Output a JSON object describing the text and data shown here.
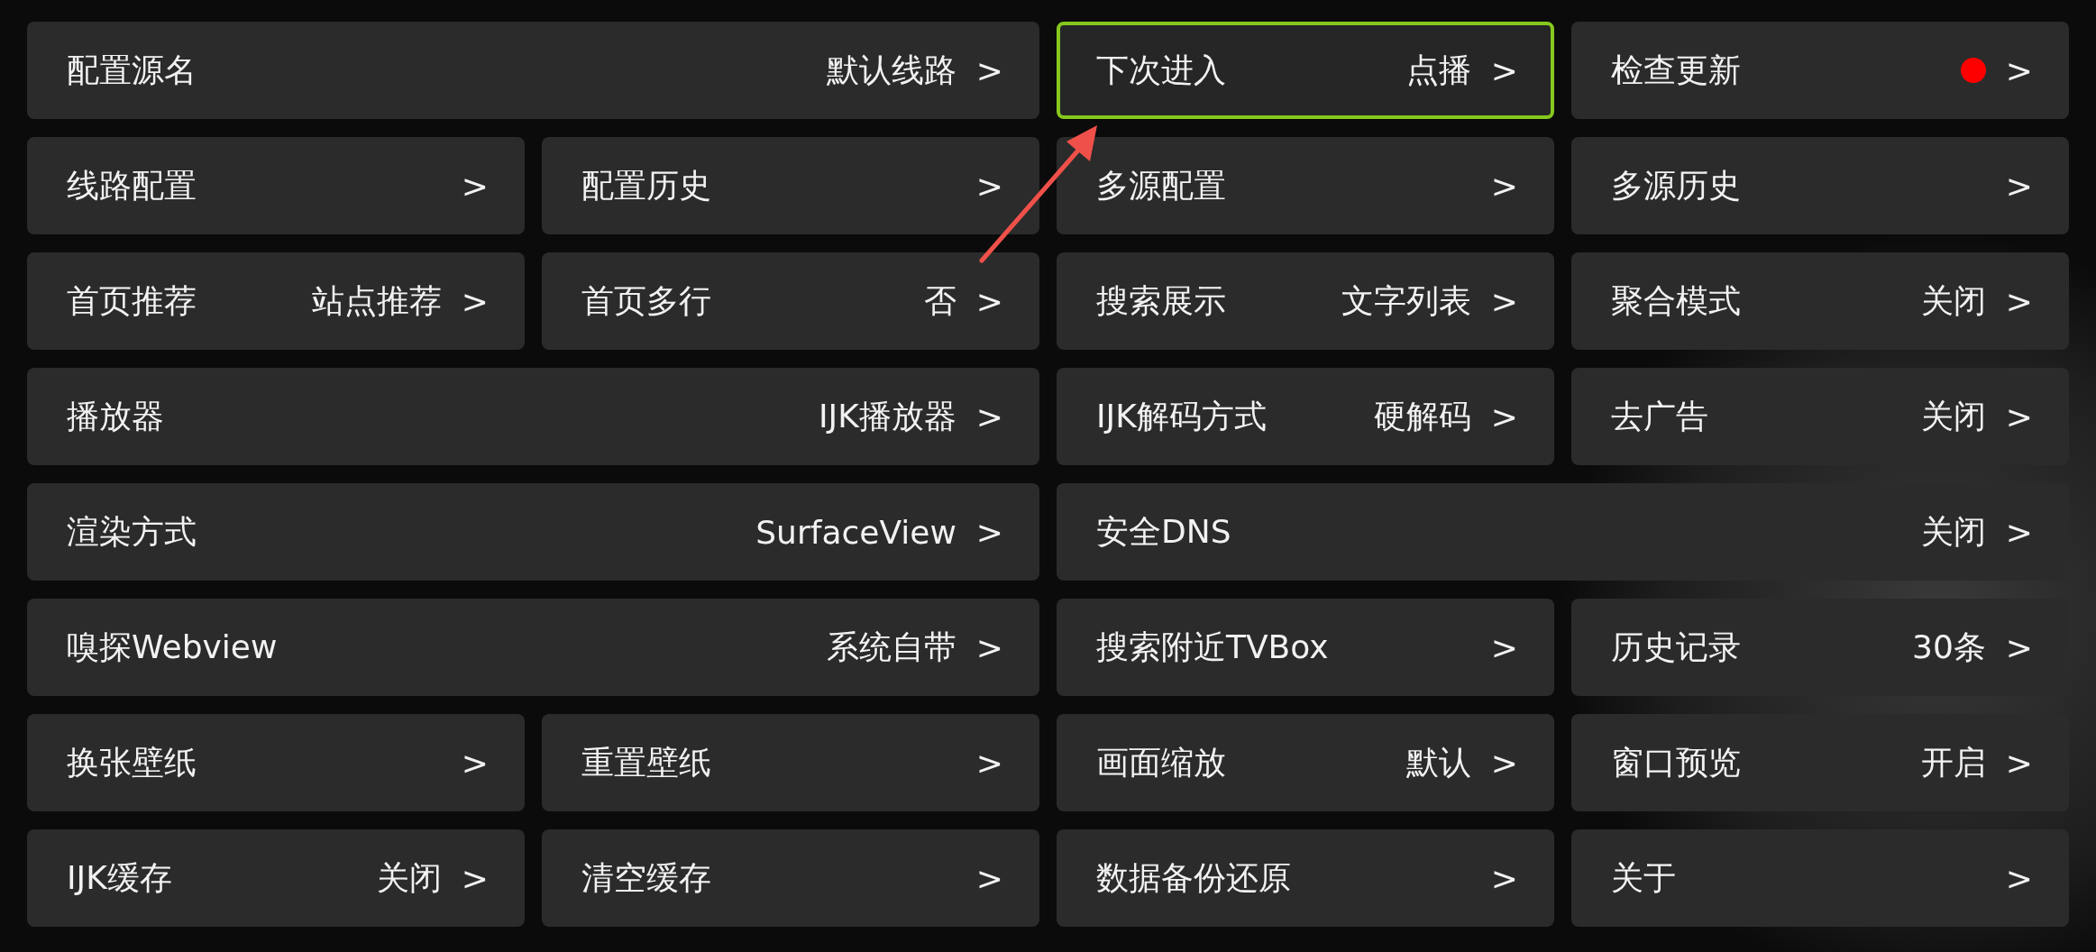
{
  "settings": [
    {
      "label": "配置源名",
      "value": "默认线路",
      "chevron": ">",
      "wide": true,
      "selected": false,
      "dot": false
    },
    {
      "label": "下次进入",
      "value": "点播",
      "chevron": ">",
      "wide": false,
      "selected": true,
      "dot": false
    },
    {
      "label": "检查更新",
      "chevron": ">",
      "wide": false,
      "selected": false,
      "dot": true
    },
    {
      "label": "线路配置",
      "chevron": ">",
      "wide": false,
      "selected": false,
      "dot": false
    },
    {
      "label": "配置历史",
      "chevron": ">",
      "wide": false,
      "selected": false,
      "dot": false
    },
    {
      "label": "多源配置",
      "chevron": ">",
      "wide": false,
      "selected": false,
      "dot": false
    },
    {
      "label": "多源历史",
      "chevron": ">",
      "wide": false,
      "selected": false,
      "dot": false
    },
    {
      "label": "首页推荐",
      "value": "站点推荐",
      "chevron": ">",
      "wide": false,
      "selected": false,
      "dot": false
    },
    {
      "label": "首页多行",
      "value": "否",
      "chevron": ">",
      "wide": false,
      "selected": false,
      "dot": false
    },
    {
      "label": "搜索展示",
      "value": "文字列表",
      "chevron": ">",
      "wide": false,
      "selected": false,
      "dot": false
    },
    {
      "label": "聚合模式",
      "value": "关闭",
      "chevron": ">",
      "wide": false,
      "selected": false,
      "dot": false
    },
    {
      "label": "播放器",
      "value": "IJK播放器",
      "chevron": ">",
      "wide": true,
      "selected": false,
      "dot": false
    },
    {
      "label": "IJK解码方式",
      "value": "硬解码",
      "chevron": ">",
      "wide": false,
      "selected": false,
      "dot": false
    },
    {
      "label": "去广告",
      "value": "关闭",
      "chevron": ">",
      "wide": false,
      "selected": false,
      "dot": false
    },
    {
      "label": "渲染方式",
      "value": "SurfaceView",
      "chevron": ">",
      "wide": true,
      "selected": false,
      "dot": false
    },
    {
      "label": "安全DNS",
      "value": "关闭",
      "chevron": ">",
      "wide": true,
      "selected": false,
      "dot": false
    },
    {
      "label": "嗅探Webview",
      "value": "系统自带",
      "chevron": ">",
      "wide": true,
      "selected": false,
      "dot": false
    },
    {
      "label": "搜索附近TVBox",
      "chevron": ">",
      "wide": false,
      "selected": false,
      "dot": false
    },
    {
      "label": "历史记录",
      "value": "30条",
      "chevron": ">",
      "wide": false,
      "selected": false,
      "dot": false
    },
    {
      "label": "换张壁纸",
      "chevron": ">",
      "wide": false,
      "selected": false,
      "dot": false
    },
    {
      "label": "重置壁纸",
      "chevron": ">",
      "wide": false,
      "selected": false,
      "dot": false
    },
    {
      "label": "画面缩放",
      "value": "默认",
      "chevron": ">",
      "wide": false,
      "selected": false,
      "dot": false
    },
    {
      "label": "窗口预览",
      "value": "开启",
      "chevron": ">",
      "wide": false,
      "selected": false,
      "dot": false
    },
    {
      "label": "IJK缓存",
      "value": "关闭",
      "chevron": ">",
      "wide": false,
      "selected": false,
      "dot": false
    },
    {
      "label": "清空缓存",
      "chevron": ">",
      "wide": false,
      "selected": false,
      "dot": false
    },
    {
      "label": "数据备份还原",
      "chevron": ">",
      "wide": false,
      "selected": false,
      "dot": false
    },
    {
      "label": "关于",
      "chevron": ">",
      "wide": false,
      "selected": false,
      "dot": false
    }
  ]
}
